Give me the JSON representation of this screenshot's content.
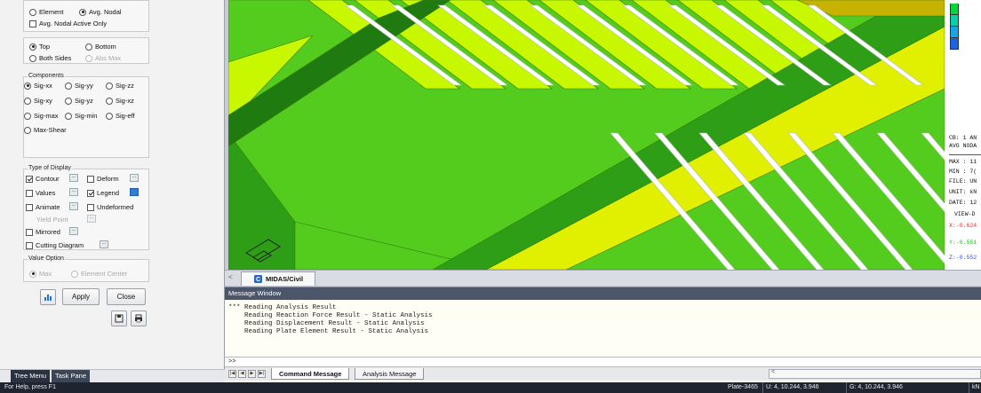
{
  "left_panel": {
    "result_type": {
      "element": "Element",
      "avg_nodal": "Avg. Nodal",
      "avg_nodal_active_only": "Avg. Nodal Active Only"
    },
    "surface": {
      "top": "Top",
      "bottom": "Bottom",
      "both_sides": "Both Sides",
      "abs_max": "Abs Max"
    },
    "components": {
      "title": "Components",
      "items": [
        "Sig-xx",
        "Sig-yy",
        "Sig-zz",
        "Sig-xy",
        "Sig-yz",
        "Sig-xz",
        "Sig-max",
        "Sig-min",
        "Sig-eff",
        "Max-Shear"
      ],
      "selected": "Sig-xx"
    },
    "type_of_display": {
      "title": "Type of Display",
      "contour": "Contour",
      "deform": "Deform",
      "values": "Values",
      "legend": "Legend",
      "animate": "Animate",
      "undeformed": "Undeformed",
      "yield_point": "Yield Point",
      "mirrored": "Mirrored",
      "cutting_diagram": "Cutting Diagram",
      "dots": "..."
    },
    "value_option": {
      "title": "Value Option",
      "max": "Max",
      "element_center": "Element Center"
    },
    "buttons": {
      "apply": "Apply",
      "close": "Close"
    },
    "tabs": {
      "tree_menu": "Tree Menu",
      "task_pane": "Task Pane"
    }
  },
  "legend": {
    "colors": [
      "#00d63c",
      "#08d0a8",
      "#16a6e8",
      "#1b62e4"
    ],
    "lines": [
      "CB: 1 AN",
      "AVG NODA",
      "MAX : 11",
      "MIN : 7(",
      "FILE: UN",
      "UNIT: kN",
      "DATE: 12",
      "VIEW-D",
      "X:-0.624",
      "Y:-0.551",
      "Z:-0.552"
    ],
    "line_colors": {
      "X": "#e03030",
      "Y": "#28b828",
      "Z": "#3050e0"
    }
  },
  "model_tab": {
    "label": "MIDAS/Civil",
    "scroll_left": "<"
  },
  "message_window": {
    "title": "Message Window",
    "lines": [
      "*** Reading Analysis Result",
      "    Reading Reaction Force Result - Static Analysis",
      "    Reading Displacement Result - Static Analysis",
      "    Reading Plate Element Result - Static Analysis"
    ],
    "prompt": ">>",
    "tabs": [
      "Command Message",
      "Analysis Message"
    ],
    "scroll_indicator": "<"
  },
  "status_bar": {
    "help": "For Help, press F1",
    "element": "Plate-3465",
    "u_coords": "U: 4, 10.244, 3.946",
    "g_coords": "G: 4, 10.244, 3.946",
    "end": "kN"
  },
  "viewport": {
    "fill_colors": {
      "bright": "#c8f800",
      "green": "#54cc1e",
      "yellow": "#e0f000",
      "dark": "#2e9e16",
      "shadow": "#1f7a10",
      "hole": "#ffffff",
      "orange": "#c8b200"
    }
  }
}
